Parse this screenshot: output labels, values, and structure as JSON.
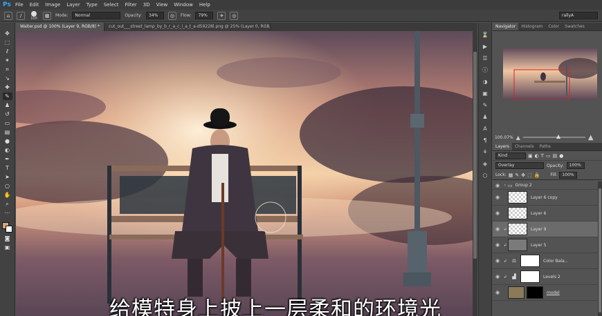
{
  "app": {
    "logo": "Ps",
    "menu": [
      "File",
      "Edit",
      "Image",
      "Layer",
      "Type",
      "Select",
      "Filter",
      "3D",
      "View",
      "Window",
      "Help"
    ]
  },
  "options_bar": {
    "brush_size": "100",
    "mode_label": "Mode:",
    "mode_value": "Normal",
    "opacity_label": "Opacity:",
    "opacity_value": "34%",
    "flow_label": "Flow:",
    "flow_value": "79%",
    "workspace": "rallyA"
  },
  "document_tabs": [
    {
      "label": "Waiter.psd @ 100% (Layer 9, RGB/8) *",
      "active": true
    },
    {
      "label": "cut_out___street_lamp_by_b_r_a_c_i_a_t_a-d59228l.png @ 25% (Layer 0, RGB/8)",
      "active": false
    }
  ],
  "canvas": {
    "subtitle": "给模特身上披上一层柔和的环境光"
  },
  "navigator": {
    "tabs": [
      "Navigator",
      "Histogram",
      "Color",
      "Swatches"
    ],
    "zoom": "100.07%"
  },
  "layers_panel": {
    "tabs": [
      "Layers",
      "Channels",
      "Paths"
    ],
    "filter_kind": "Kind",
    "blend_mode": "Overlay",
    "opacity_label": "Opacity:",
    "opacity_value": "100%",
    "lock_label": "Lock:",
    "fill_label": "Fill:",
    "fill_value": "100%",
    "layers": [
      {
        "name": "Group 2",
        "type": "group"
      },
      {
        "name": "Layer 6 copy",
        "type": "pixel"
      },
      {
        "name": "Layer 6",
        "type": "pixel"
      },
      {
        "name": "Layer 9",
        "type": "pixel",
        "selected": true
      },
      {
        "name": "Layer 5",
        "type": "pixel"
      },
      {
        "name": "Color Bala...",
        "type": "adjustment"
      },
      {
        "name": "Levels 2",
        "type": "adjustment"
      },
      {
        "name": "model",
        "type": "masked"
      }
    ]
  },
  "colors": {
    "foreground": "#d9a57b",
    "background": "#ffffff",
    "accent": "#31a8ff"
  }
}
